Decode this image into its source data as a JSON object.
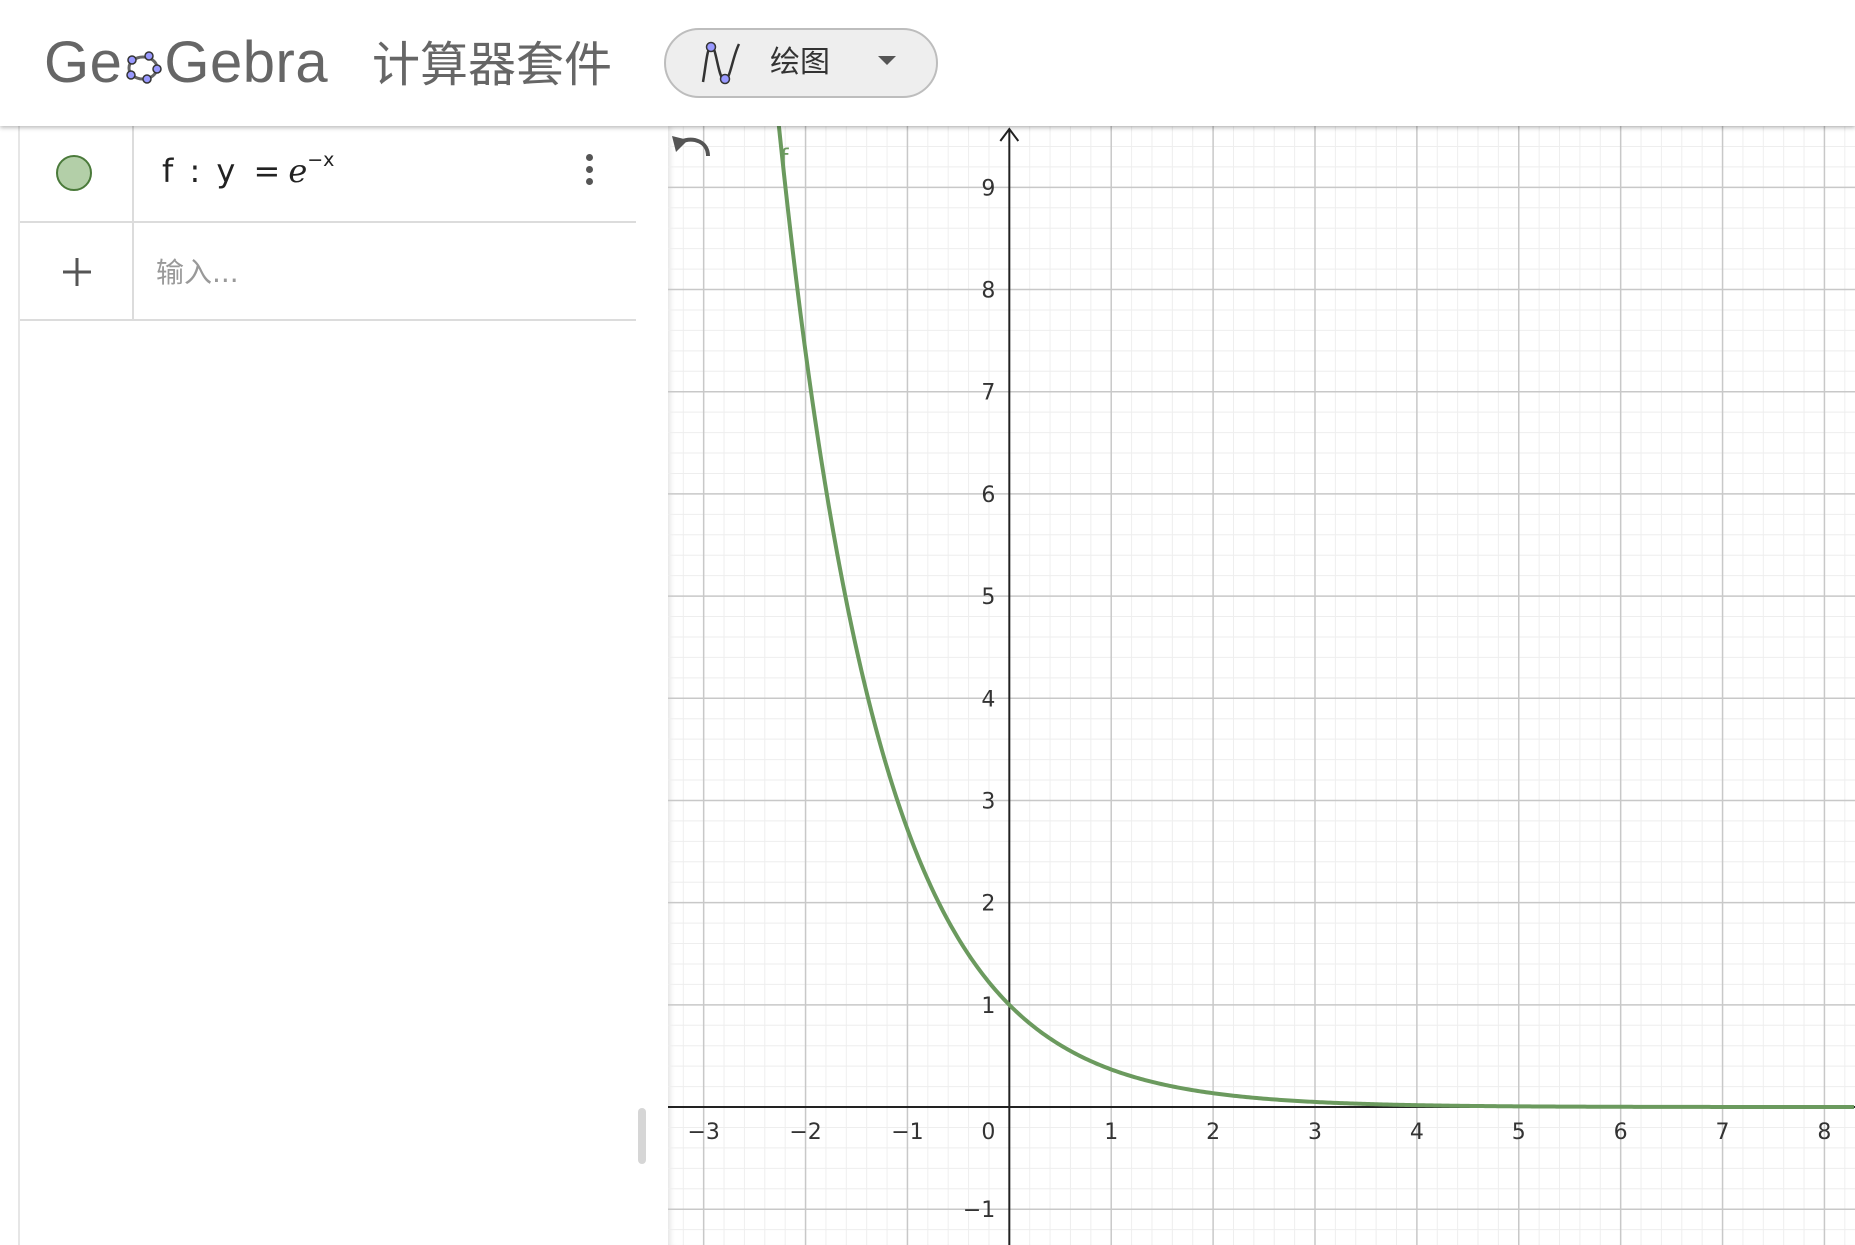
{
  "header": {
    "logo_text": "GeoGebra",
    "app_title": "计算器套件",
    "app_switcher": {
      "label": "绘图",
      "icon": "graphing-icon",
      "dropdown_icon": "caret-down-icon"
    }
  },
  "algebra": {
    "items": [
      {
        "label": "f",
        "separator": ":",
        "lhs": "y",
        "eq": "=",
        "base": "e",
        "exponent": "−x",
        "color": "#4a7a3a"
      }
    ],
    "input_placeholder": "输入...",
    "more_icon": "more-vert-icon",
    "add_icon": "plus-icon"
  },
  "graphics": {
    "undo_icon": "undo-icon",
    "function_label": "f",
    "curve_color": "#6b9a5e"
  },
  "chart_data": {
    "type": "line",
    "title": "",
    "xlabel": "",
    "ylabel": "",
    "xlim": [
      -3.35,
      8.3
    ],
    "ylim": [
      -1.35,
      9.6
    ],
    "x_ticks": [
      -3,
      -2,
      -1,
      1,
      2,
      3,
      4,
      5,
      6,
      7,
      8
    ],
    "x_tick_labels": [
      "−3",
      "−2",
      "−1",
      "1",
      "2",
      "3",
      "4",
      "5",
      "6",
      "7",
      "8"
    ],
    "y_ticks": [
      -1,
      1,
      2,
      3,
      4,
      5,
      6,
      7,
      8,
      9
    ],
    "y_tick_labels": [
      "−1",
      "1",
      "2",
      "3",
      "4",
      "5",
      "6",
      "7",
      "8",
      "9"
    ],
    "origin_label": "0",
    "grid": true,
    "minor_grid": true,
    "series": [
      {
        "name": "f",
        "expression": "e^(-x)",
        "x": [
          -2.27,
          -2,
          -1.5,
          -1,
          -0.5,
          0,
          0.5,
          1,
          1.5,
          2,
          3,
          4,
          5,
          6,
          7,
          8.3
        ],
        "y": [
          9.68,
          7.389,
          4.482,
          2.718,
          1.649,
          1.0,
          0.607,
          0.368,
          0.223,
          0.135,
          0.05,
          0.018,
          0.007,
          0.002,
          0.001,
          0.0
        ]
      }
    ]
  }
}
